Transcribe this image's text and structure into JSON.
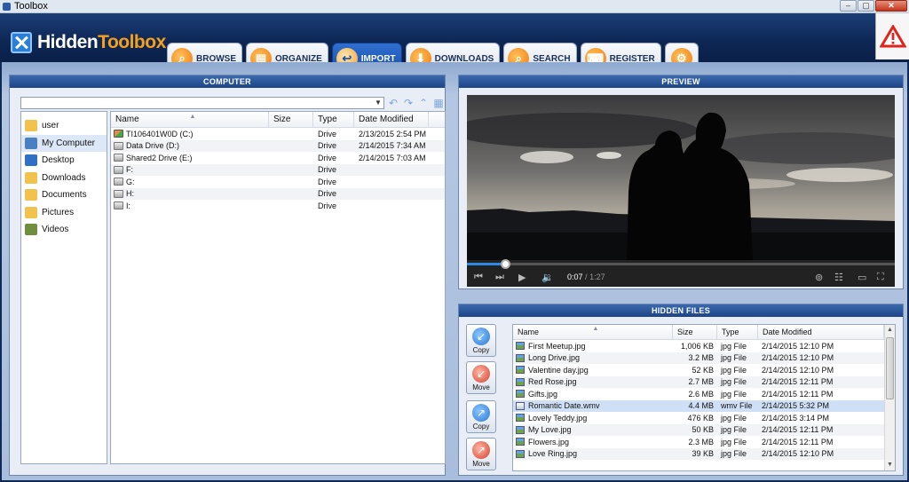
{
  "window": {
    "title": "Toolbox",
    "buttons": [
      "–",
      "▢",
      "✕"
    ]
  },
  "brand": {
    "name_part1": "Hidden",
    "name_part2": "Toolbox"
  },
  "tabs": [
    {
      "label": "BROWSE",
      "icon": "browse-icon",
      "glyph": "⌕",
      "active": false
    },
    {
      "label": "ORGANIZE",
      "icon": "organize-icon",
      "glyph": "▤",
      "active": false
    },
    {
      "label": "IMPORT",
      "icon": "import-icon",
      "glyph": "↩",
      "active": true
    },
    {
      "label": "DOWNLOADS",
      "icon": "downloads-icon",
      "glyph": "⬇",
      "active": false
    },
    {
      "label": "SEARCH",
      "icon": "search-icon",
      "glyph": "⌕",
      "active": false
    },
    {
      "label": "REGISTER",
      "icon": "register-icon",
      "glyph": "⌨",
      "active": false
    },
    {
      "label": "",
      "icon": "settings-icon",
      "glyph": "⚙",
      "active": false
    }
  ],
  "computer": {
    "title": "COMPUTER",
    "path_value": "",
    "sidebar": [
      {
        "label": "user",
        "icon": "user-folder-icon",
        "color": "#f2c24f",
        "selected": false
      },
      {
        "label": "My Computer",
        "icon": "computer-icon",
        "color": "#4a7fc1",
        "selected": true
      },
      {
        "label": "Desktop",
        "icon": "desktop-icon",
        "color": "#2f6fc4",
        "selected": false
      },
      {
        "label": "Downloads",
        "icon": "downloads-folder-icon",
        "color": "#f2c24f",
        "selected": false
      },
      {
        "label": "Documents",
        "icon": "documents-folder-icon",
        "color": "#f2c24f",
        "selected": false
      },
      {
        "label": "Pictures",
        "icon": "pictures-folder-icon",
        "color": "#f2c24f",
        "selected": false
      },
      {
        "label": "Videos",
        "icon": "videos-folder-icon",
        "color": "#6e8f3e",
        "selected": false
      }
    ],
    "columns": [
      "Name",
      "Size",
      "Type",
      "Date Modified"
    ],
    "rows": [
      {
        "name": "TI106401W0D (C:)",
        "size": "",
        "type": "Drive",
        "date": "2/13/2015 2:54 PM",
        "icon": "windows-drive-icon"
      },
      {
        "name": "Data Drive (D:)",
        "size": "",
        "type": "Drive",
        "date": "2/14/2015 7:34 AM",
        "icon": "drive-icon"
      },
      {
        "name": "Shared2 Drive (E:)",
        "size": "",
        "type": "Drive",
        "date": "2/14/2015 7:03 AM",
        "icon": "drive-icon"
      },
      {
        "name": "F:",
        "size": "",
        "type": "Drive",
        "date": "",
        "icon": "drive-icon"
      },
      {
        "name": "G:",
        "size": "",
        "type": "Drive",
        "date": "",
        "icon": "drive-icon"
      },
      {
        "name": "H:",
        "size": "",
        "type": "Drive",
        "date": "",
        "icon": "drive-icon"
      },
      {
        "name": "I:",
        "size": "",
        "type": "Drive",
        "date": "",
        "icon": "drive-icon"
      }
    ]
  },
  "preview": {
    "title": "PREVIEW",
    "current_time": "0:07",
    "separator": "/",
    "duration": "1:27",
    "progress": 0.09
  },
  "hidden_files": {
    "title": "HIDDEN FILES",
    "actions": [
      {
        "label": "Copy",
        "icon": "copy-in-icon"
      },
      {
        "label": "Move",
        "icon": "move-in-icon"
      },
      {
        "label": "Copy",
        "icon": "copy-out-icon"
      },
      {
        "label": "Move",
        "icon": "move-out-icon"
      }
    ],
    "columns": [
      "Name",
      "Size",
      "Type",
      "Date Modified"
    ],
    "rows": [
      {
        "name": "First Meetup.jpg",
        "size": "1,006 KB",
        "type": "jpg File",
        "date": "2/14/2015 12:10 PM",
        "kind": "jpg"
      },
      {
        "name": "Long Drive.jpg",
        "size": "3.2 MB",
        "type": "jpg File",
        "date": "2/14/2015 12:10 PM",
        "kind": "jpg"
      },
      {
        "name": "Valentine day.jpg",
        "size": "52 KB",
        "type": "jpg File",
        "date": "2/14/2015 12:10 PM",
        "kind": "jpg"
      },
      {
        "name": "Red Rose.jpg",
        "size": "2.7 MB",
        "type": "jpg File",
        "date": "2/14/2015 12:11 PM",
        "kind": "jpg"
      },
      {
        "name": "Gifts.jpg",
        "size": "2.6 MB",
        "type": "jpg File",
        "date": "2/14/2015 12:11 PM",
        "kind": "jpg"
      },
      {
        "name": "Romantic Date.wmv",
        "size": "4.4 MB",
        "type": "wmv File",
        "date": "2/14/2015 5:32 PM",
        "kind": "wmv",
        "selected": true
      },
      {
        "name": "Lovely Teddy.jpg",
        "size": "476 KB",
        "type": "jpg File",
        "date": "2/14/2015 3:14 PM",
        "kind": "jpg"
      },
      {
        "name": "My Love.jpg",
        "size": "50 KB",
        "type": "jpg File",
        "date": "2/14/2015 12:11 PM",
        "kind": "jpg"
      },
      {
        "name": "Flowers.jpg",
        "size": "2.3 MB",
        "type": "jpg File",
        "date": "2/14/2015 12:11 PM",
        "kind": "jpg"
      },
      {
        "name": "Love Ring.jpg",
        "size": "39 KB",
        "type": "jpg File",
        "date": "2/14/2015 12:10 PM",
        "kind": "jpg"
      }
    ]
  }
}
